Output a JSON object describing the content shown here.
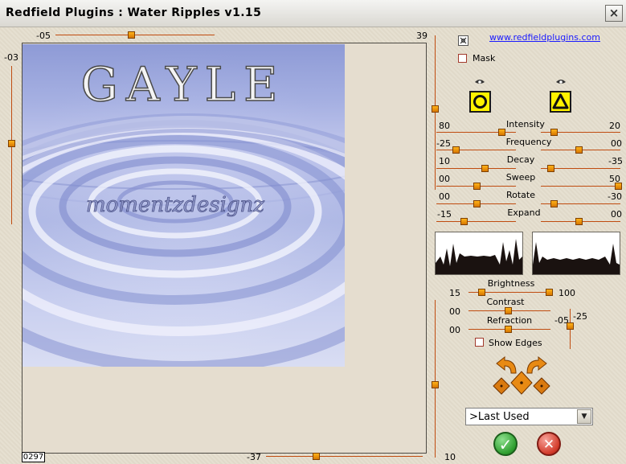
{
  "window": {
    "title": "Redfield Plugins : Water Ripples v1.15",
    "close_glyph": "×"
  },
  "link": "www.redfieldplugins.com",
  "mask": {
    "label": "Mask",
    "checked": false
  },
  "preview": {
    "top_offset_label": "-05",
    "top_right_label": "39",
    "left_offset_label": "-03",
    "bottom_offset_label": "-37",
    "bottom_right_label": "10",
    "zoom_readout": "0297",
    "image_text": "GAYLE",
    "watermark": "momentzdesignz"
  },
  "params": [
    {
      "name": "Intensity",
      "left": "80",
      "right": "20"
    },
    {
      "name": "Frequency",
      "left": "-25",
      "right": "00"
    },
    {
      "name": "Decay",
      "left": "10",
      "right": "-35"
    },
    {
      "name": "Sweep",
      "left": "00",
      "right": "50"
    },
    {
      "name": "Rotate",
      "left": "00",
      "right": "-30"
    },
    {
      "name": "Expand",
      "left": "-15",
      "right": "00"
    }
  ],
  "light": {
    "brightness": {
      "name": "Brightness",
      "left": "15",
      "right": "100"
    },
    "contrast": {
      "name": "Contrast",
      "left": "00"
    },
    "refraction": {
      "name": "Refraction",
      "left": "00"
    },
    "vertical": {
      "left": "-05",
      "right": "-25"
    }
  },
  "show_edges": {
    "label": "Show Edges",
    "checked": false
  },
  "preset": {
    "selected": "&gt;Last Used"
  },
  "icons": {
    "ok": "✓",
    "cancel": "✕",
    "dropdown": "▼"
  },
  "colors": {
    "accent": "#c04c10",
    "ok": "#2e9e2e",
    "cancel": "#d23a2a"
  }
}
